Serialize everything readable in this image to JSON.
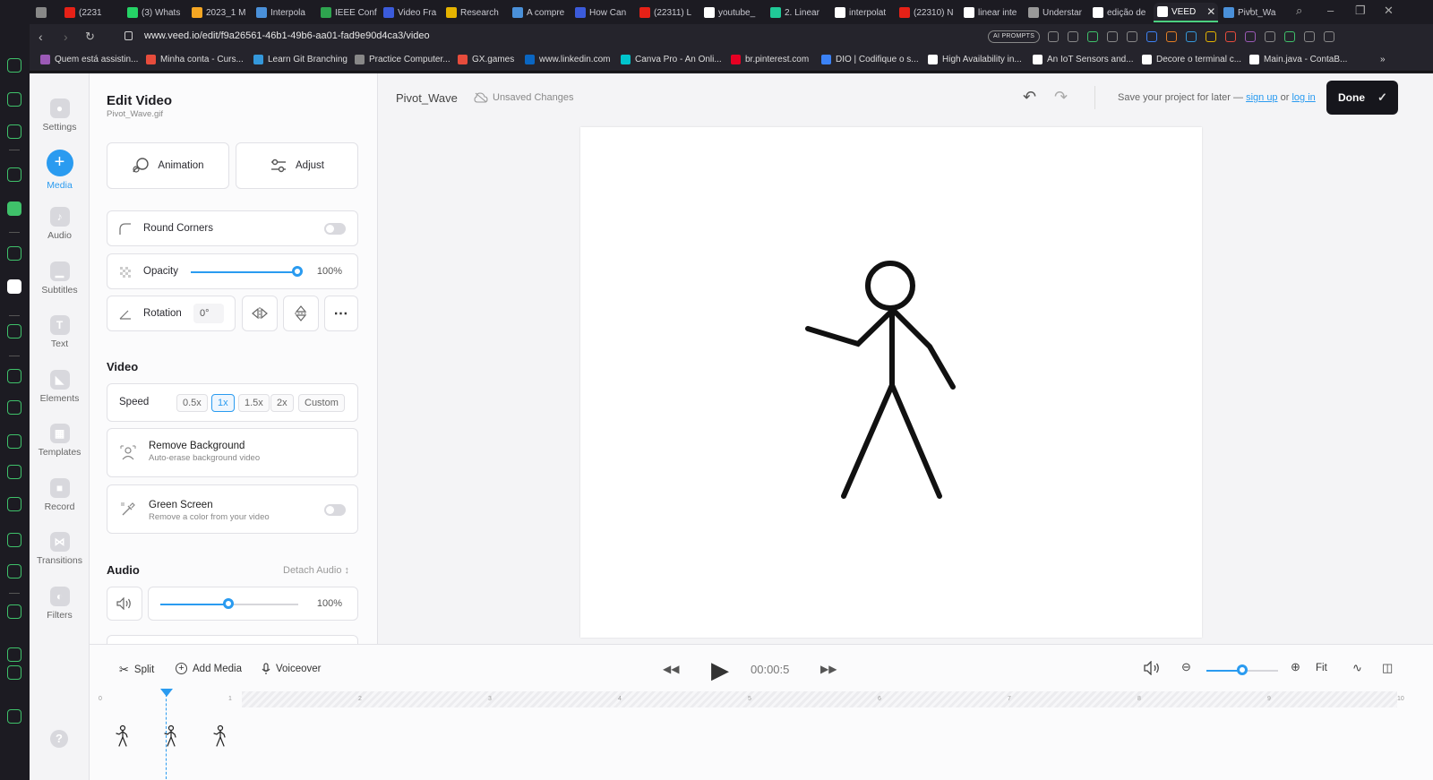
{
  "browser": {
    "tabs": [
      {
        "label": "",
        "color": "#888"
      },
      {
        "label": "(2231",
        "color": "#e62117"
      },
      {
        "label": "(3) Whats",
        "color": "#25d366"
      },
      {
        "label": "2023_1 M",
        "color": "#f5a623"
      },
      {
        "label": "Interpola",
        "color": "#4a90d9"
      },
      {
        "label": "IEEE Conf",
        "color": "#2ea44f"
      },
      {
        "label": "Video Fra",
        "color": "#3b5bdb"
      },
      {
        "label": "Research",
        "color": "#e5b300"
      },
      {
        "label": "A compre",
        "color": "#4a90d9"
      },
      {
        "label": "How Can",
        "color": "#3b5bdb"
      },
      {
        "label": "(22311) L",
        "color": "#e62117"
      },
      {
        "label": "youtube_",
        "color": "#ffffff"
      },
      {
        "label": "2. Linear",
        "color": "#20c997"
      },
      {
        "label": "interpolat",
        "color": "#ffffff"
      },
      {
        "label": "(22310) N",
        "color": "#e62117"
      },
      {
        "label": "linear inte",
        "color": "#ffffff"
      },
      {
        "label": "Understar",
        "color": "#999"
      },
      {
        "label": "edição de",
        "color": "#ffffff"
      },
      {
        "label": "VEED",
        "color": "#ffffff",
        "active": true
      },
      {
        "label": "Pivot_Wa",
        "color": "#4a90d9"
      }
    ],
    "url": "www.veed.io/edit/f9a26561-46b1-49b6-aa01-fad9e90d4ca3/video",
    "ai_prompts_label": "AI PROMPTS",
    "bookmarks": [
      {
        "label": "Quem está assistin...",
        "color": "#9b59b6"
      },
      {
        "label": "Minha conta - Curs...",
        "color": "#e74c3c"
      },
      {
        "label": "Learn Git Branching",
        "color": "#3498db"
      },
      {
        "label": "Practice Computer...",
        "color": "#888"
      },
      {
        "label": "GX.games",
        "color": "#e74c3c"
      },
      {
        "label": "www.linkedin.com",
        "color": "#0a66c2"
      },
      {
        "label": "Canva Pro - An Onli...",
        "color": "#00c4cc"
      },
      {
        "label": "br.pinterest.com",
        "color": "#e60023"
      },
      {
        "label": "DIO | Codifique o s...",
        "color": "#3b82f6"
      },
      {
        "label": "High Availability in...",
        "color": "#ffffff"
      },
      {
        "label": "An IoT Sensors and...",
        "color": "#ffffff"
      },
      {
        "label": "Decore o terminal c...",
        "color": "#ffffff"
      },
      {
        "label": "Main.java - ContaB...",
        "color": "#ffffff"
      }
    ]
  },
  "rail": [
    {
      "label": "Settings",
      "icon": "gear-icon"
    },
    {
      "label": "Media",
      "icon": "plus-icon",
      "active": true
    },
    {
      "label": "Audio",
      "icon": "music-note-icon"
    },
    {
      "label": "Subtitles",
      "icon": "subtitles-icon"
    },
    {
      "label": "Text",
      "icon": "text-icon"
    },
    {
      "label": "Elements",
      "icon": "elements-icon"
    },
    {
      "label": "Templates",
      "icon": "templates-icon"
    },
    {
      "label": "Record",
      "icon": "record-icon"
    },
    {
      "label": "Transitions",
      "icon": "transitions-icon"
    },
    {
      "label": "Filters",
      "icon": "filters-icon"
    }
  ],
  "panel": {
    "title": "Edit Video",
    "filename": "Pivot_Wave.gif",
    "animation_label": "Animation",
    "adjust_label": "Adjust",
    "round_corners_label": "Round Corners",
    "opacity_label": "Opacity",
    "opacity_value": "100%",
    "opacity_level": 1.0,
    "rotation_label": "Rotation",
    "rotation_value": "0°",
    "video_section": "Video",
    "speed_label": "Speed",
    "speed_options": [
      "0.5x",
      "1x",
      "1.5x",
      "2x",
      "Custom"
    ],
    "speed_selected": "1x",
    "remove_bg_title": "Remove Background",
    "remove_bg_sub": "Auto-erase background video",
    "green_screen_title": "Green Screen",
    "green_screen_sub": "Remove a color from your video",
    "audio_section": "Audio",
    "detach_audio": "Detach Audio",
    "volume_value": "100%",
    "volume_level": 0.5
  },
  "topbar": {
    "project_name": "Pivot_Wave",
    "unsaved": "Unsaved Changes",
    "save_prefix": "Save your project for later —",
    "sign_up": "sign up",
    "or": "or",
    "log_in": "log in",
    "done": "Done"
  },
  "timeline": {
    "split": "Split",
    "add_media": "Add Media",
    "voiceover": "Voiceover",
    "time": "00:00:5",
    "fit": "Fit",
    "ticks": [
      "0",
      "1",
      "2",
      "3",
      "4",
      "5",
      "6",
      "7",
      "8",
      "9",
      "10"
    ],
    "zoom_level": 0.5
  },
  "colors": {
    "accent": "#2a9bf0",
    "done_bg": "#16161c",
    "opera_green": "#3fc16a"
  }
}
